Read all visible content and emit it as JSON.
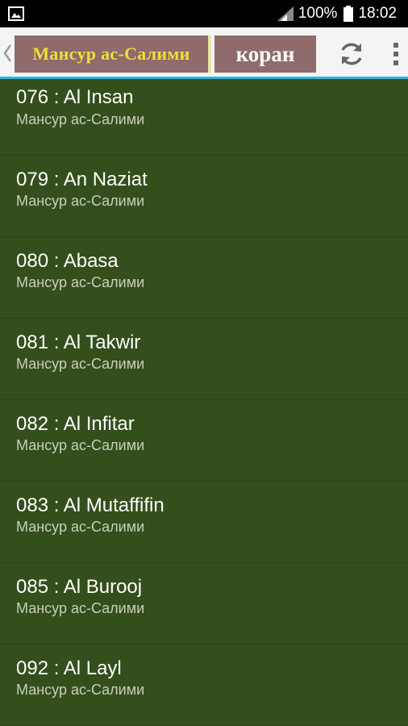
{
  "status_bar": {
    "battery_percent": "100%",
    "time": "18:02"
  },
  "app_bar": {
    "title": "Мансур ас-Салими",
    "subtitle": "коран",
    "icons": [
      "back-chevron",
      "refresh",
      "overflow-menu"
    ]
  },
  "colors": {
    "list_background": "#344f1c",
    "title_box": "#8f6b6b",
    "title_text": "#f0de3a",
    "accent_line": "#2fb1e0"
  },
  "list": {
    "items": [
      {
        "title": "076 : Al Insan",
        "subtitle": "Мансур ас-Салими"
      },
      {
        "title": "079 : An Naziat",
        "subtitle": "Мансур ас-Салими"
      },
      {
        "title": "080 : Abasa",
        "subtitle": "Мансур ас-Салими"
      },
      {
        "title": "081 : Al Takwir",
        "subtitle": "Мансур ас-Салими"
      },
      {
        "title": "082 : Al Infitar",
        "subtitle": "Мансур ас-Салими"
      },
      {
        "title": "083 : Al Mutaffifin",
        "subtitle": "Мансур ас-Салими"
      },
      {
        "title": "085 : Al Burooj",
        "subtitle": "Мансур ас-Салими"
      },
      {
        "title": "092 : Al Layl",
        "subtitle": "Мансур ас-Салими"
      }
    ]
  }
}
